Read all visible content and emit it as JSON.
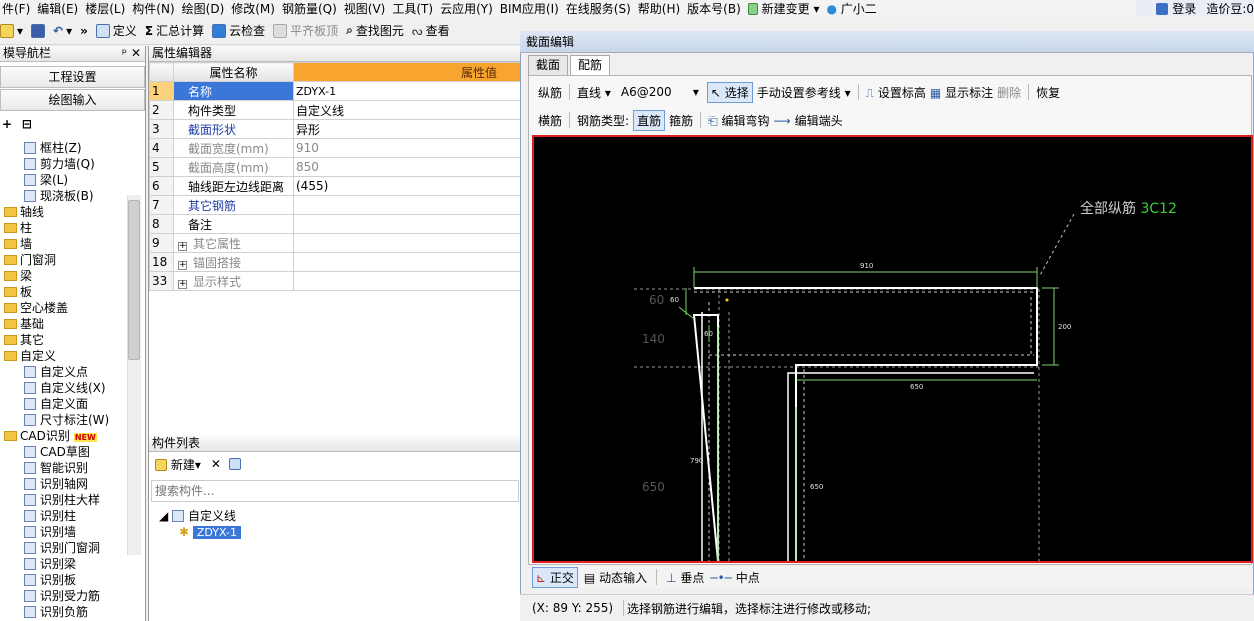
{
  "menubar": {
    "items": [
      "件(F)",
      "编辑(E)",
      "楼层(L)",
      "构件(N)",
      "绘图(D)",
      "修改(M)",
      "钢筋量(Q)",
      "视图(V)",
      "工具(T)",
      "云应用(Y)",
      "BIM应用(I)",
      "在线服务(S)",
      "帮助(H)",
      "版本号(B)",
      "新建变更",
      "广小二"
    ],
    "login": "登录",
    "coins": "造价豆:0"
  },
  "toolbar": {
    "define": "定义",
    "sum": "汇总计算",
    "cloudcheck": "云检查",
    "flatten": "平齐板顶",
    "find": "查找图元",
    "view": "查看"
  },
  "nav": {
    "title": "模导航栏",
    "pin": "ᵖ",
    "close": "✕",
    "btn_project": "工程设置",
    "btn_draw": "绘图输入",
    "items": [
      {
        "label": "框柱(Z)",
        "level": 2,
        "icon": "column-icon"
      },
      {
        "label": "剪力墙(Q)",
        "level": 2,
        "icon": "wall-icon"
      },
      {
        "label": "梁(L)",
        "level": 2,
        "icon": "beam-icon"
      },
      {
        "label": "现浇板(B)",
        "level": 2,
        "icon": "slab-icon"
      },
      {
        "label": "轴线",
        "level": 1,
        "icon": "folder-icon"
      },
      {
        "label": "柱",
        "level": 1,
        "icon": "folder-icon"
      },
      {
        "label": "墙",
        "level": 1,
        "icon": "folder-icon"
      },
      {
        "label": "门窗洞",
        "level": 1,
        "icon": "folder-icon"
      },
      {
        "label": "梁",
        "level": 1,
        "icon": "folder-icon"
      },
      {
        "label": "板",
        "level": 1,
        "icon": "folder-icon"
      },
      {
        "label": "空心楼盖",
        "level": 1,
        "icon": "folder-icon"
      },
      {
        "label": "基础",
        "level": 1,
        "icon": "folder-icon"
      },
      {
        "label": "其它",
        "level": 1,
        "icon": "folder-icon"
      },
      {
        "label": "自定义",
        "level": 1,
        "icon": "folder-open-icon"
      },
      {
        "label": "自定义点",
        "level": 2,
        "icon": "point-icon"
      },
      {
        "label": "自定义线(X)",
        "level": 2,
        "icon": "line-icon"
      },
      {
        "label": "自定义面",
        "level": 2,
        "icon": "area-icon"
      },
      {
        "label": "尺寸标注(W)",
        "level": 2,
        "icon": "dimension-icon"
      },
      {
        "label": "CAD识别",
        "level": 1,
        "icon": "folder-open-icon"
      },
      {
        "label": "CAD草图",
        "level": 2,
        "icon": "cad-icon"
      },
      {
        "label": "智能识别",
        "level": 2,
        "icon": "cad-icon"
      },
      {
        "label": "识别轴网",
        "level": 2,
        "icon": "cad-icon"
      },
      {
        "label": "识别柱大样",
        "level": 2,
        "icon": "cad-icon"
      },
      {
        "label": "识别柱",
        "level": 2,
        "icon": "cad-icon"
      },
      {
        "label": "识别墙",
        "level": 2,
        "icon": "cad-icon"
      },
      {
        "label": "识别门窗洞",
        "level": 2,
        "icon": "cad-icon"
      },
      {
        "label": "识别梁",
        "level": 2,
        "icon": "cad-icon"
      },
      {
        "label": "识别板",
        "level": 2,
        "icon": "cad-icon"
      },
      {
        "label": "识别受力筋",
        "level": 2,
        "icon": "cad-icon"
      },
      {
        "label": "识别负筋",
        "level": 2,
        "icon": "cad-icon"
      }
    ],
    "new_badge": "NEW"
  },
  "prop": {
    "title": "属性编辑器",
    "col_name": "属性名称",
    "col_value": "属性值",
    "rows": [
      {
        "no": "1",
        "name": "名称",
        "value": "ZDYX-1",
        "style": "selected"
      },
      {
        "no": "2",
        "name": "构件类型",
        "value": "自定义线",
        "style": ""
      },
      {
        "no": "3",
        "name": "截面形状",
        "value": "异形",
        "style": "blue"
      },
      {
        "no": "4",
        "name": "截面宽度(mm)",
        "value": "910",
        "style": "gray"
      },
      {
        "no": "5",
        "name": "截面高度(mm)",
        "value": "850",
        "style": "gray"
      },
      {
        "no": "6",
        "name": "轴线距左边线距离",
        "value": "(455)",
        "style": ""
      },
      {
        "no": "7",
        "name": "其它钢筋",
        "value": "",
        "style": "blue"
      },
      {
        "no": "8",
        "name": "备注",
        "value": "",
        "style": ""
      },
      {
        "no": "9",
        "name": "其它属性",
        "value": "",
        "style": "group"
      },
      {
        "no": "18",
        "name": "锚固搭接",
        "value": "",
        "style": "group"
      },
      {
        "no": "33",
        "name": "显示样式",
        "value": "",
        "style": "group"
      }
    ]
  },
  "clist": {
    "title": "构件列表",
    "new_label": "新建",
    "search_placeholder": "搜索构件...",
    "root": "自定义线",
    "child": "ZDYX-1"
  },
  "dialog": {
    "title": "截面编辑",
    "tabs": [
      "截面",
      "配筋"
    ],
    "row1": {
      "long": "纵筋",
      "linetype": "直线",
      "spec": "A6@200",
      "select": "选择",
      "manual": "手动设置参考线",
      "set_elev": "设置标高",
      "show_dim": "显示标注",
      "delete": "删除",
      "restore": "恢复"
    },
    "row2": {
      "cross": "横筋",
      "type_label": "钢筋类型:",
      "straight": "直筋",
      "stirrup": "箍筋",
      "edit_hook": "编辑弯钩",
      "edit_end": "编辑端头"
    },
    "canvas": {
      "callout": "全部纵筋",
      "callout_spec": "3C12",
      "dims": [
        "910",
        "60",
        "200",
        "60",
        "650",
        "790",
        "650"
      ],
      "ghost_dims": [
        "60",
        "140",
        "650"
      ]
    },
    "status1": {
      "ortho": "正交",
      "dynamic": "动态输入",
      "perp": "垂点",
      "mid": "中点"
    },
    "coords": "(X: 89 Y: 255)",
    "hint": "选择钢筋进行编辑，选择标注进行修改或移动;"
  },
  "colors": {
    "accent": "#3b77d8",
    "canvas_border": "#e0201e",
    "dim_green": "#7bd36a",
    "callout_green": "#3ad13a"
  }
}
